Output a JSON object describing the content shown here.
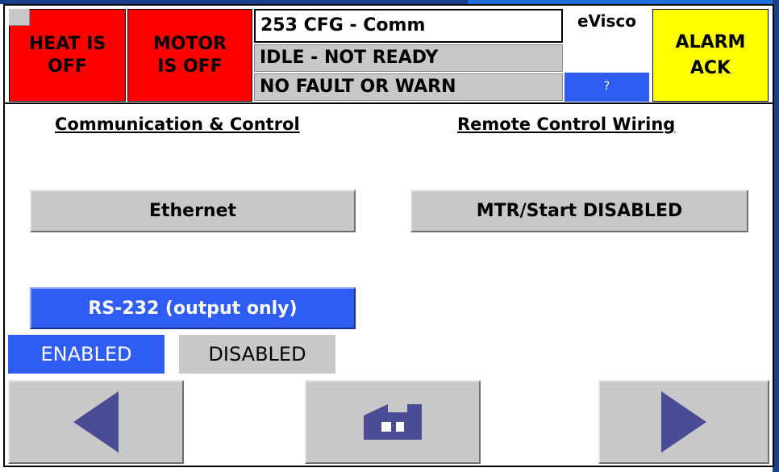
{
  "header": {
    "heat_status": "HEAT IS OFF",
    "motor_status": "MOTOR IS OFF",
    "screen_title": "253 CFG - Comm",
    "state_line": "IDLE - NOT READY",
    "fault_line": "NO  FAULT OR WARN",
    "brand": "eVisco",
    "help_label": "?",
    "alarm_ack": "ALARM ACK"
  },
  "sections": {
    "left_heading": "Communication & Control",
    "right_heading": "Remote Control Wiring"
  },
  "buttons": {
    "ethernet": "Ethernet",
    "motor_start": "MTR/Start  DISABLED",
    "rs232": "RS-232 (output only)"
  },
  "toggle": {
    "enabled": "ENABLED",
    "disabled": "DISABLED",
    "selected": "ENABLED"
  },
  "nav": {
    "prev_icon": "left-triangle-icon",
    "home_icon": "factory-icon",
    "next_icon": "right-triangle-icon"
  },
  "colors": {
    "heat_motor_bg": "#ff0000",
    "alarm_bg": "#ffff00",
    "active_blue": "#2f5df3",
    "button_gray": "#c8c8c8",
    "nav_arrow": "#4a4c96"
  }
}
